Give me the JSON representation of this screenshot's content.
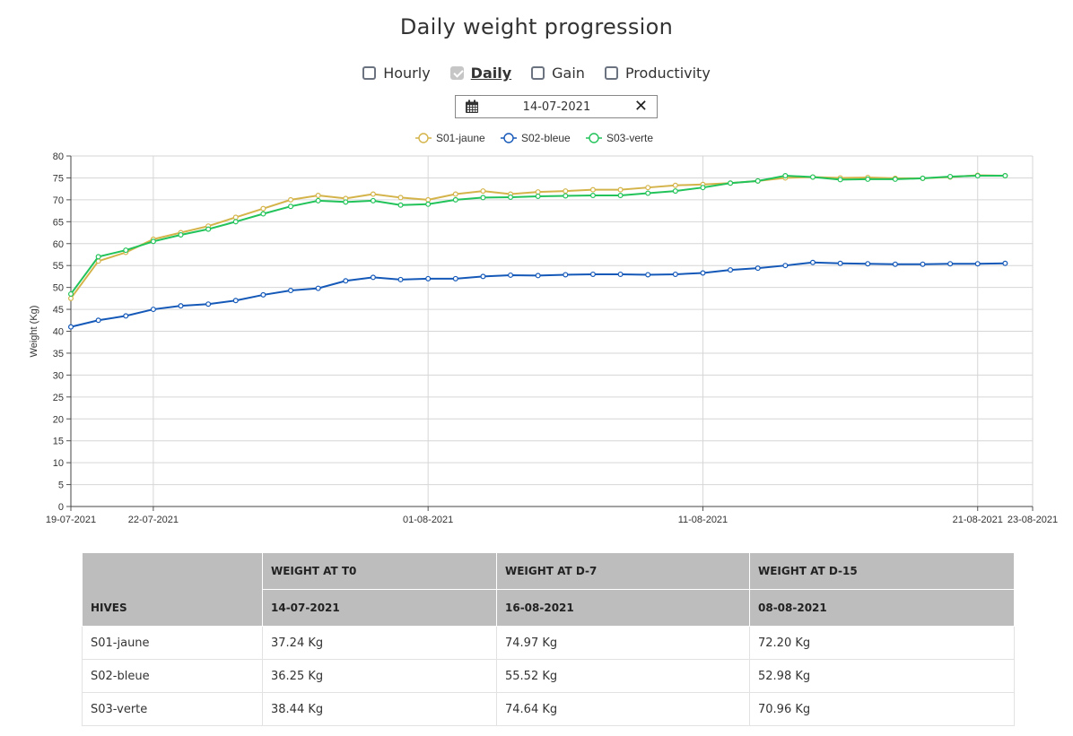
{
  "page": {
    "title": "Daily weight progression"
  },
  "filters": [
    {
      "label": "Hourly",
      "checked": false
    },
    {
      "label": "Daily",
      "checked": true
    },
    {
      "label": "Gain",
      "checked": false
    },
    {
      "label": "Productivity",
      "checked": false
    }
  ],
  "date_picker": {
    "value": "14-07-2021"
  },
  "icons": {
    "calendar": "calendar-icon",
    "clear": "close-icon"
  },
  "chart_data": {
    "type": "line",
    "ylabel": "Weight (Kg)",
    "ylim": [
      0,
      80
    ],
    "ytick_step": 5,
    "xlim": [
      "19-07-2021",
      "23-08-2021"
    ],
    "xtick_labels": [
      "19-07-2021",
      "22-07-2021",
      "01-08-2021",
      "11-08-2021",
      "21-08-2021",
      "23-08-2021"
    ],
    "grid": true,
    "legend": "top-center",
    "dates": [
      "19-07-2021",
      "20-07-2021",
      "21-07-2021",
      "22-07-2021",
      "23-07-2021",
      "24-07-2021",
      "25-07-2021",
      "26-07-2021",
      "27-07-2021",
      "28-07-2021",
      "29-07-2021",
      "30-07-2021",
      "31-07-2021",
      "01-08-2021",
      "02-08-2021",
      "03-08-2021",
      "04-08-2021",
      "05-08-2021",
      "06-08-2021",
      "07-08-2021",
      "08-08-2021",
      "09-08-2021",
      "10-08-2021",
      "11-08-2021",
      "12-08-2021",
      "13-08-2021",
      "14-08-2021",
      "15-08-2021",
      "16-08-2021",
      "17-08-2021",
      "18-08-2021",
      "19-08-2021",
      "20-08-2021",
      "21-08-2021",
      "22-08-2021"
    ],
    "series": [
      {
        "name": "S01-jaune",
        "color": "#d4b44a",
        "values": [
          47.5,
          56.0,
          58.0,
          61.0,
          62.5,
          64.0,
          66.0,
          68.0,
          70.0,
          71.0,
          70.3,
          71.3,
          70.5,
          70.0,
          71.3,
          72.0,
          71.3,
          71.8,
          72.0,
          72.3,
          72.3,
          72.8,
          73.3,
          73.5,
          73.8,
          74.3,
          75.0,
          75.2,
          75.0,
          75.1,
          74.9,
          74.9,
          75.2,
          75.6,
          75.5
        ]
      },
      {
        "name": "S02-bleue",
        "color": "#1458b8",
        "values": [
          41.0,
          42.5,
          43.5,
          45.0,
          45.8,
          46.2,
          47.0,
          48.3,
          49.3,
          49.8,
          51.5,
          52.3,
          51.8,
          52.0,
          52.0,
          52.5,
          52.8,
          52.7,
          52.9,
          53.0,
          53.0,
          52.9,
          53.0,
          53.3,
          54.0,
          54.4,
          55.0,
          55.7,
          55.5,
          55.4,
          55.3,
          55.3,
          55.4,
          55.4,
          55.5
        ]
      },
      {
        "name": "S03-verte",
        "color": "#22c35a",
        "values": [
          48.5,
          57.0,
          58.5,
          60.5,
          62.0,
          63.3,
          65.0,
          66.8,
          68.5,
          69.8,
          69.5,
          69.8,
          68.8,
          69.0,
          70.0,
          70.5,
          70.6,
          70.8,
          70.9,
          71.0,
          71.0,
          71.5,
          72.0,
          72.8,
          73.8,
          74.3,
          75.5,
          75.2,
          74.6,
          74.7,
          74.7,
          74.9,
          75.3,
          75.5,
          75.5
        ]
      }
    ]
  },
  "table": {
    "header_row1": [
      "HIVES",
      "WEIGHT AT T0",
      "WEIGHT AT D-7",
      "WEIGHT AT D-15"
    ],
    "header_row2": [
      "14-07-2021",
      "16-08-2021",
      "08-08-2021"
    ],
    "rows": [
      [
        "S01-jaune",
        "37.24 Kg",
        "74.97 Kg",
        "72.20 Kg"
      ],
      [
        "S02-bleue",
        "36.25 Kg",
        "55.52 Kg",
        "52.98 Kg"
      ],
      [
        "S03-verte",
        "38.44 Kg",
        "74.64 Kg",
        "70.96 Kg"
      ]
    ]
  }
}
